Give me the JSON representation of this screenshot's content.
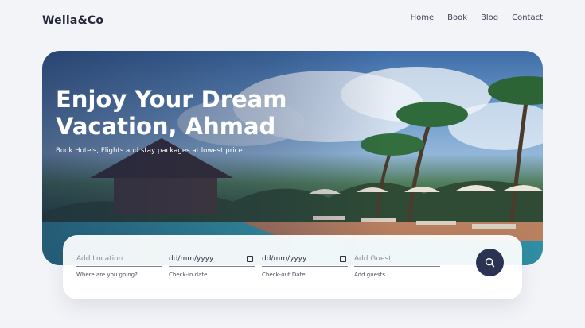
{
  "brand": {
    "name": "Wella&Co"
  },
  "nav": {
    "items": [
      "Home",
      "Book",
      "Blog",
      "Contact"
    ]
  },
  "hero": {
    "title_line1": "Enjoy Your Dream",
    "title_line2": "Vacation, Ahmad",
    "subtitle": "Book Hotels, Flights and stay packages at lowest price."
  },
  "search": {
    "location": {
      "placeholder": "Add Location",
      "hint": "Where are you going?"
    },
    "checkin": {
      "value": "dd/mm/yyyy",
      "hint": "Check-in date"
    },
    "checkout": {
      "value": "dd/mm/yyyy",
      "hint": "Check-out Date"
    },
    "guests": {
      "placeholder": "Add Guest",
      "hint": "Add guests"
    },
    "button_icon": "search-icon"
  },
  "colors": {
    "background": "#f3f4f8",
    "accent": "#2a3352",
    "text": "#23263a"
  }
}
